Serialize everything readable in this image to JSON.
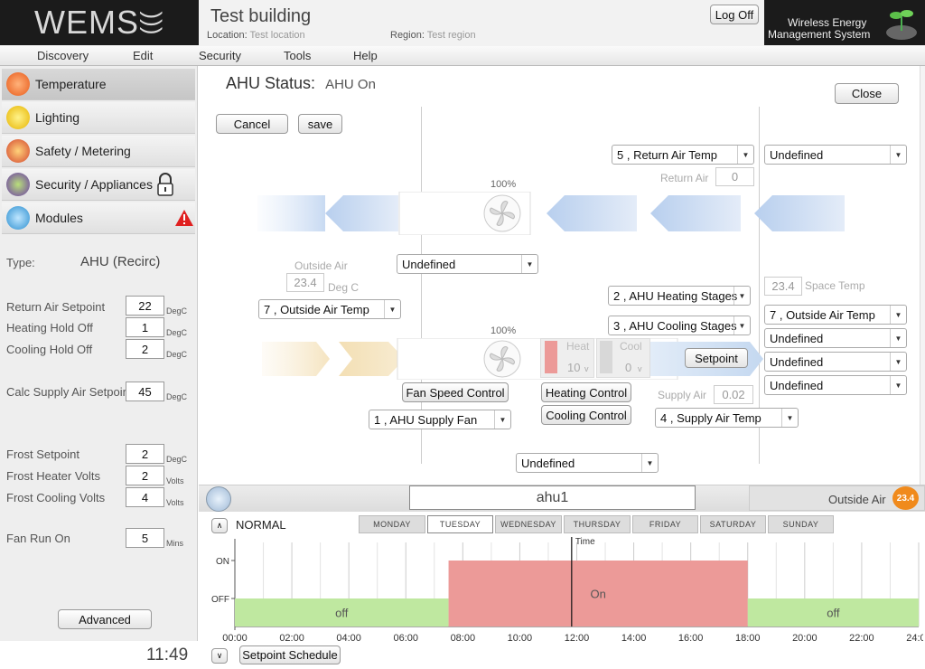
{
  "header": {
    "logo": "WEMS",
    "building": "Test building",
    "location_label": "Location:",
    "location_value": "Test location",
    "region_label": "Region:",
    "region_value": "Test region",
    "logoff": "Log Off",
    "brand_line1": "Wireless Energy",
    "brand_line2": "Management System"
  },
  "menu": [
    "Discovery",
    "Edit",
    "Security",
    "Tools",
    "Help"
  ],
  "sidebar": {
    "items": [
      {
        "label": "Temperature"
      },
      {
        "label": "Lighting"
      },
      {
        "label": "Safety / Metering"
      },
      {
        "label": "Security / Appliances"
      },
      {
        "label": "Modules"
      }
    ],
    "type_label": "Type:",
    "type_value": "AHU (Recirc)",
    "fields": [
      {
        "label": "Return Air Setpoint",
        "value": "22",
        "unit": "DegC"
      },
      {
        "label": "Heating Hold Off",
        "value": "1",
        "unit": "DegC"
      },
      {
        "label": "Cooling Hold Off",
        "value": "2",
        "unit": "DegC"
      },
      {
        "label": "Calc Supply Air Setpoint",
        "value": "45",
        "unit": "DegC"
      },
      {
        "label": "Frost Setpoint",
        "value": "2",
        "unit": "DegC"
      },
      {
        "label": "Frost Heater Volts",
        "value": "2",
        "unit": "Volts"
      },
      {
        "label": "Frost Cooling Volts",
        "value": "4",
        "unit": "Volts"
      },
      {
        "label": "Fan Run On",
        "value": "5",
        "unit": "Mins"
      }
    ],
    "advanced": "Advanced",
    "clock": "11:49"
  },
  "main": {
    "status_label": "AHU Status:",
    "status_value": "AHU On",
    "close": "Close",
    "cancel": "Cancel",
    "save": "save",
    "return_air_sel": "5 , Return Air Temp",
    "undef_top_right": "Undefined",
    "return_air_label": "Return Air",
    "return_air_value": "0",
    "fan_pct_top": "100%",
    "fan_pct_bottom": "100%",
    "outside_air_label": "Outside Air",
    "outside_air_value": "23.4",
    "outside_air_unit": "Deg C",
    "outside_air_sel": "7 , Outside Air Temp",
    "undef_mid": "Undefined",
    "space_temp_value": "23.4",
    "space_temp_label": "Space Temp",
    "heating_stages_sel": "2 , AHU Heating Stages",
    "cooling_stages_sel": "3 , AHU Cooling Stages",
    "right_sel_1": "7 , Outside Air Temp",
    "right_sel_2": "Undefined",
    "right_sel_3": "Undefined",
    "right_sel_4": "Undefined",
    "heat_label": "Heat",
    "heat_value": "10",
    "heat_unit": "v",
    "cool_label": "Cool",
    "cool_value": "0",
    "cool_unit": "v",
    "setpoint_btn": "Setpoint",
    "fan_speed_btn": "Fan Speed Control",
    "heating_ctrl_btn": "Heating Control",
    "cooling_ctrl_btn": "Cooling Control",
    "supply_air_label": "Supply Air",
    "supply_air_value": "0.02",
    "supply_fan_sel": "1 , AHU Supply Fan",
    "supply_air_sel": "4 , Supply Air Temp",
    "undef_bottom": "Undefined"
  },
  "schedule": {
    "name": "ahu1",
    "outside_air_label": "Outside Air",
    "outside_air_value": "23.4",
    "mode": "NORMAL",
    "days": [
      "MONDAY",
      "TUESDAY",
      "WEDNESDAY",
      "THURSDAY",
      "FRIDAY",
      "SATURDAY",
      "SUNDAY"
    ],
    "selected_day": "TUESDAY",
    "setpoint_schedule_btn": "Setpoint Schedule"
  },
  "chart_data": {
    "type": "area",
    "x_ticks": [
      "00:00",
      "02:00",
      "04:00",
      "06:00",
      "08:00",
      "10:00",
      "12:00",
      "14:00",
      "16:00",
      "18:00",
      "20:00",
      "22:00",
      "24:00"
    ],
    "y_ticks": [
      "ON",
      "OFF"
    ],
    "xlim": [
      0,
      24
    ],
    "time_marker_label": "Time",
    "time_marker": 11.82,
    "segments": [
      {
        "start": 0,
        "end": 7.5,
        "state": "OFF",
        "label": "off",
        "color": "#bfe8a0"
      },
      {
        "start": 7.5,
        "end": 18,
        "state": "ON",
        "label": "On",
        "color": "#ec9a98"
      },
      {
        "start": 18,
        "end": 24,
        "state": "OFF",
        "label": "off",
        "color": "#bfe8a0"
      }
    ]
  }
}
